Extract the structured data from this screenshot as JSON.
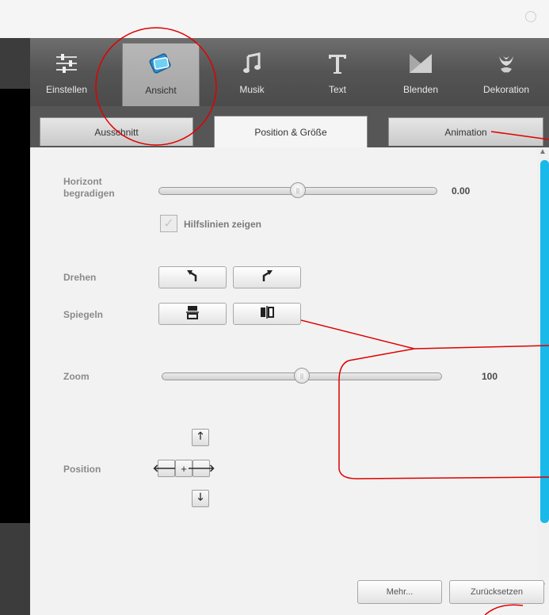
{
  "toolbar": {
    "items": [
      {
        "label": "Einstellen",
        "icon": "sliders-icon"
      },
      {
        "label": "Ansicht",
        "icon": "photo-view-icon"
      },
      {
        "label": "Musik",
        "icon": "music-note-icon"
      },
      {
        "label": "Text",
        "icon": "text-t-icon"
      },
      {
        "label": "Blenden",
        "icon": "transition-icon"
      },
      {
        "label": "Dekoration",
        "icon": "decoration-flower-icon"
      }
    ],
    "active": "Ansicht"
  },
  "subtabs": [
    {
      "label": "Ausschnitt"
    },
    {
      "label": "Position & Größe"
    },
    {
      "label": "Animation"
    }
  ],
  "form": {
    "horizont_label": "Horizont begradigen",
    "horizont_value": "0.00",
    "horizont_level": 0.5,
    "hilfslinien_label": "Hilfslinien zeigen",
    "hilfslinien_checked": true,
    "drehen_label": "Drehen",
    "spiegeln_label": "Spiegeln",
    "zoom_label": "Zoom",
    "zoom_value": "100",
    "zoom_level": 0.5,
    "position_label": "Position"
  },
  "footer": {
    "more_label": "Mehr...",
    "reset_label": "Zurücksetzen"
  },
  "colors": {
    "accent_scroll": "#19b9ea",
    "annotation_red": "#e00000"
  }
}
